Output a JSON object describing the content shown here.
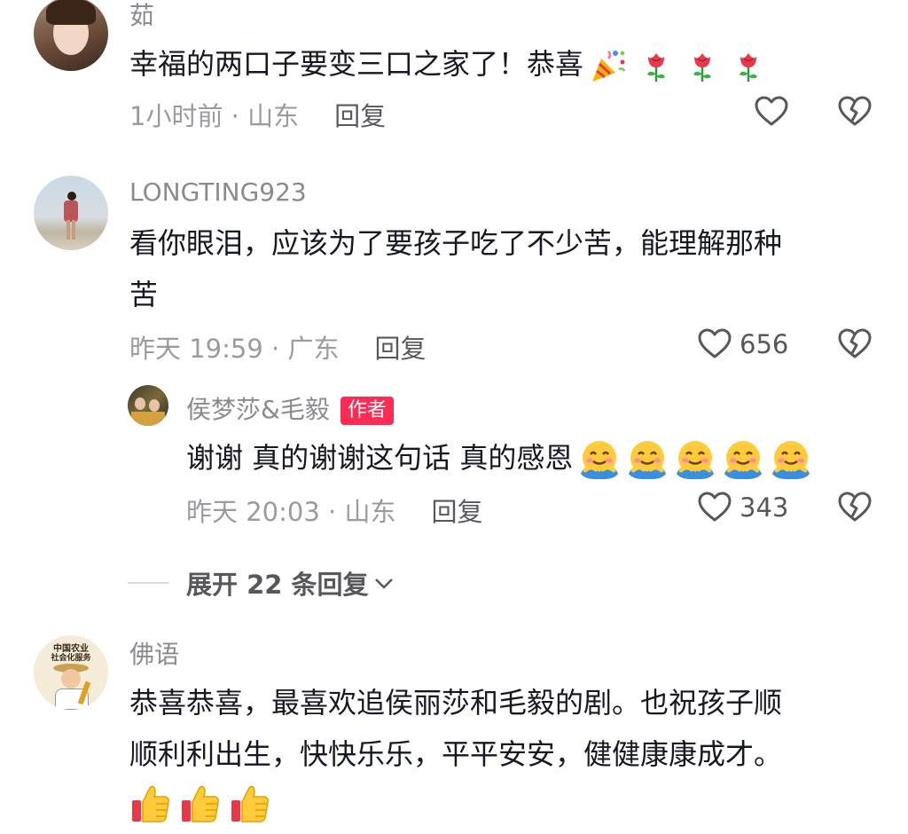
{
  "comments": [
    {
      "username": "茹",
      "text": "幸福的两口子要变三口之家了！恭喜",
      "emojis": [
        "party-popper",
        "rose",
        "rose",
        "rose"
      ],
      "time": "1小时前 · 山东",
      "reply_label": "回复",
      "likes": ""
    },
    {
      "username": "LONGTING923",
      "text_line1": "看你眼泪，应该为了要孩子吃了不少苦，能理解那种",
      "text_line2": "苦",
      "time": "昨天 19:59 · 广东",
      "reply_label": "回复",
      "likes": "656",
      "reply": {
        "username": "侯梦莎&毛毅",
        "badge": "作者",
        "text": "谢谢 真的谢谢这句话 真的感恩",
        "emojis": [
          "hugging",
          "hugging",
          "hugging",
          "hugging",
          "hugging"
        ],
        "time": "昨天 20:03 · 山东",
        "reply_label": "回复",
        "likes": "343"
      },
      "expand_label": "展开 22 条回复"
    },
    {
      "username": "佛语",
      "avatar_text_line1": "中国农业",
      "avatar_text_line2": "社会化服务",
      "text_line1": "恭喜恭喜，最喜欢追侯丽莎和毛毅的剧。也祝孩子顺",
      "text_line2": "顺利利出生，快快乐乐，平平安安，健健康康成才。",
      "emojis": [
        "thumbs-up",
        "thumbs-up",
        "thumbs-up"
      ]
    }
  ],
  "colors": {
    "accent": "#fe2c55",
    "text": "#161823",
    "meta": "#9a9ba1"
  }
}
